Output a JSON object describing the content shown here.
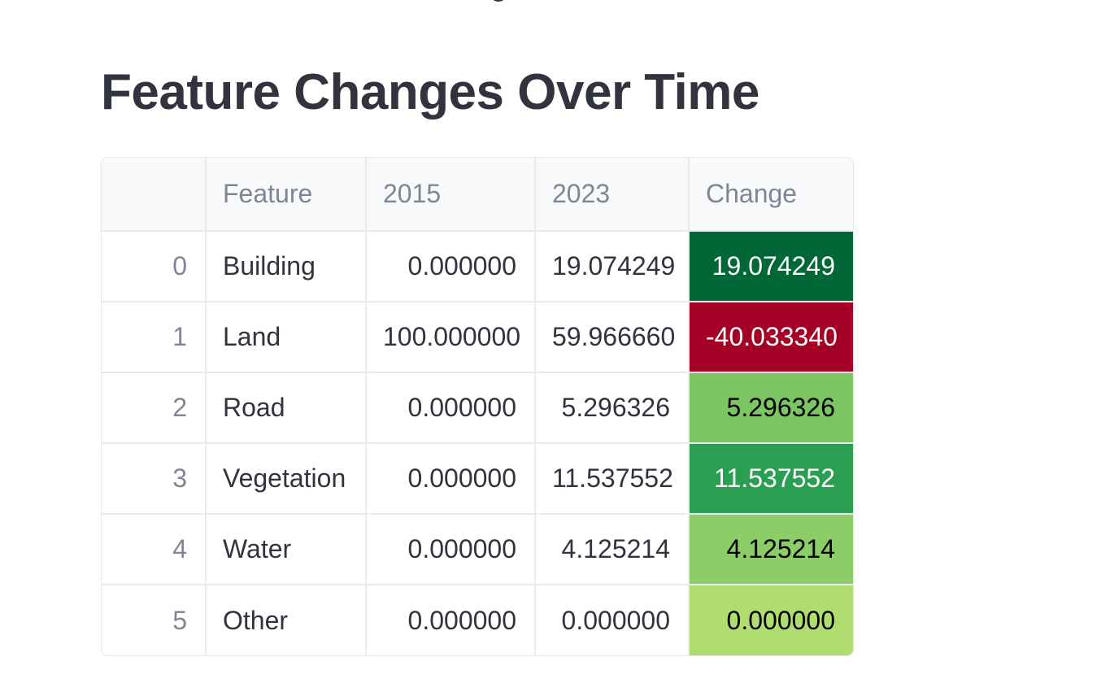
{
  "page": {
    "title": "Feature Changes Over Time"
  },
  "table": {
    "headers": [
      "",
      "Feature",
      "2015",
      "2023",
      "Change"
    ],
    "rows": [
      {
        "index": "0",
        "feature": "Building",
        "y2015": "0.000000",
        "y2023": "19.074249",
        "change": "19.074249"
      },
      {
        "index": "1",
        "feature": "Land",
        "y2015": "100.000000",
        "y2023": "59.966660",
        "change": "-40.033340"
      },
      {
        "index": "2",
        "feature": "Road",
        "y2015": "0.000000",
        "y2023": "5.296326",
        "change": "5.296326"
      },
      {
        "index": "3",
        "feature": "Vegetation",
        "y2015": "0.000000",
        "y2023": "11.537552",
        "change": "11.537552"
      },
      {
        "index": "4",
        "feature": "Water",
        "y2015": "0.000000",
        "y2023": "4.125214",
        "change": "4.125214"
      },
      {
        "index": "5",
        "feature": "Other",
        "y2015": "0.000000",
        "y2023": "0.000000",
        "change": "0.000000"
      }
    ]
  },
  "colors": {
    "title_text": "#31333f",
    "header_bg": "#f8f9fb",
    "header_text": "#808495",
    "grid_line": "#e8eaee",
    "change_cells": [
      {
        "bg": "#006837",
        "text": "#ffffff"
      },
      {
        "bg": "#a50026",
        "text": "#ffffff"
      },
      {
        "bg": "#7bc562",
        "text": "#000000"
      },
      {
        "bg": "#2b9f51",
        "text": "#ffffff"
      },
      {
        "bg": "#8ccd67",
        "text": "#000000"
      },
      {
        "bg": "#b0dd70",
        "text": "#000000"
      }
    ]
  }
}
